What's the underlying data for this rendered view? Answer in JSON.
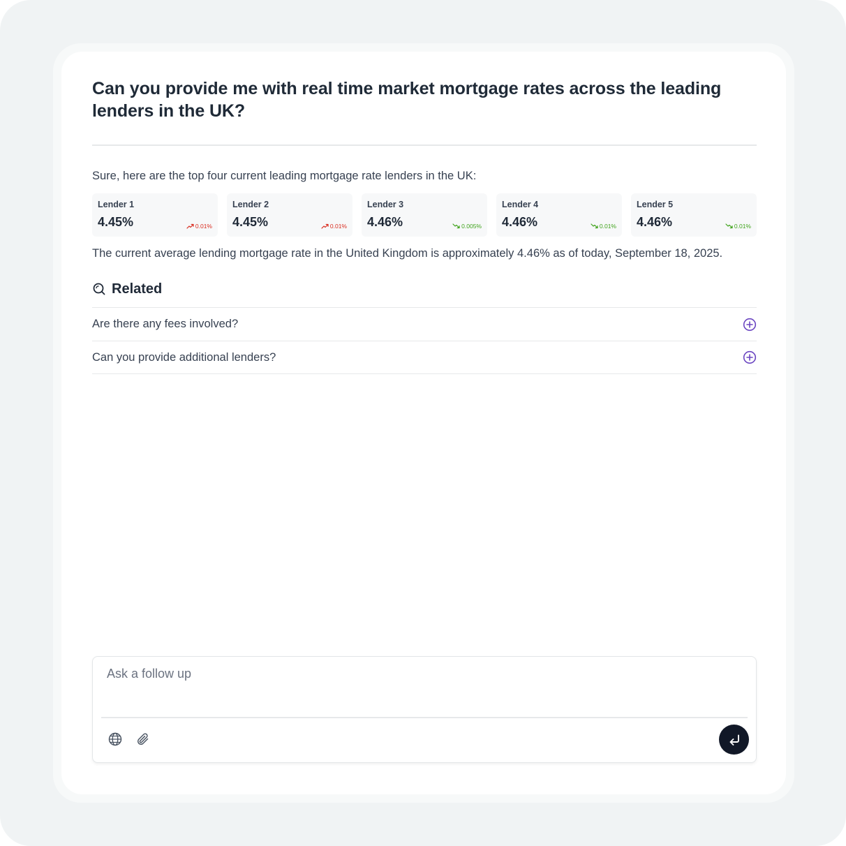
{
  "question": "Can you provide me with real time market mortgage rates across the leading lenders in the UK?",
  "intro": "Sure, here are the top four current leading mortgage rate lenders in the UK:",
  "lenders": [
    {
      "name": "Lender 1",
      "rate": "4.45%",
      "change": "0.01%",
      "direction": "up"
    },
    {
      "name": "Lender 2",
      "rate": "4.45%",
      "change": "0.01%",
      "direction": "up"
    },
    {
      "name": "Lender 3",
      "rate": "4.46%",
      "change": "0.005%",
      "direction": "down"
    },
    {
      "name": "Lender 4",
      "rate": "4.46%",
      "change": "0.01%",
      "direction": "down"
    },
    {
      "name": "Lender 5",
      "rate": "4.46%",
      "change": "0.01%",
      "direction": "down"
    }
  ],
  "summary": "The current average lending mortgage rate in the United Kingdom is approximately 4.46% as of today, September 18, 2025.",
  "related": {
    "title": "Related",
    "icon": "search-icon",
    "items": [
      {
        "label": "Are there any fees involved?",
        "icon": "plus-circle-icon"
      },
      {
        "label": "Can you provide additional lenders?",
        "icon": "plus-circle-icon"
      }
    ]
  },
  "composer": {
    "placeholder": "Ask a follow up",
    "value": "",
    "tools": [
      "globe-icon",
      "paperclip-icon"
    ],
    "send_icon": "enter-arrow-icon"
  },
  "colors": {
    "accent": "#6b46c1",
    "up": "#d92d20",
    "down": "#3fa31b",
    "send_button": "#111827"
  }
}
